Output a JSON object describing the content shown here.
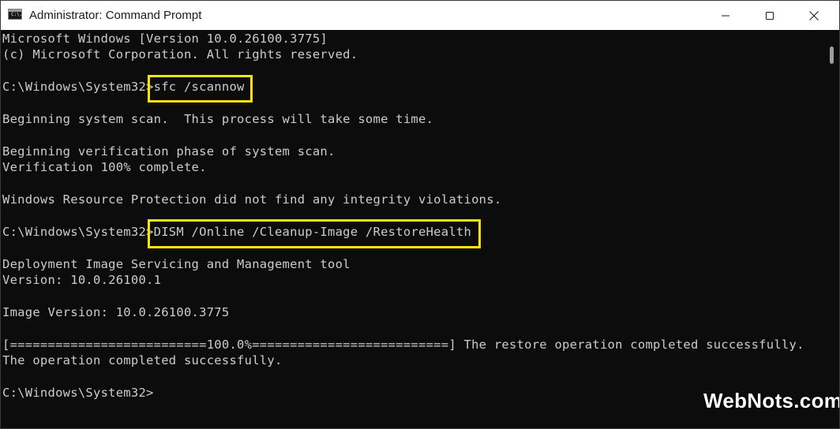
{
  "window": {
    "title": "Administrator: Command Prompt",
    "icon_name": "cmd-icon",
    "icon_glyph": "C:\\.",
    "controls": [
      "minimize-icon",
      "maximize-icon",
      "close-icon"
    ]
  },
  "console": {
    "lines": [
      "Microsoft Windows [Version 10.0.26100.3775]",
      "(c) Microsoft Corporation. All rights reserved.",
      "",
      "C:\\Windows\\System32>sfc /scannow",
      "",
      "Beginning system scan.  This process will take some time.",
      "",
      "Beginning verification phase of system scan.",
      "Verification 100% complete.",
      "",
      "Windows Resource Protection did not find any integrity violations.",
      "",
      "C:\\Windows\\System32>DISM /Online /Cleanup-Image /RestoreHealth",
      "",
      "Deployment Image Servicing and Management tool",
      "Version: 10.0.26100.1",
      "",
      "Image Version: 10.0.26100.3775",
      "",
      "[==========================100.0%==========================] The restore operation completed successfully.",
      "The operation completed successfully.",
      "",
      "C:\\Windows\\System32>"
    ],
    "highlighted_commands": [
      "sfc /scannow",
      "DISM /Online /Cleanup-Image /RestoreHealth"
    ]
  },
  "colors": {
    "console_bg": "#0c0c0c",
    "console_text": "#cccccc",
    "highlight": "#ffe500",
    "titlebar_bg": "#ffffff"
  },
  "watermark": {
    "text": "WebNots.com"
  }
}
